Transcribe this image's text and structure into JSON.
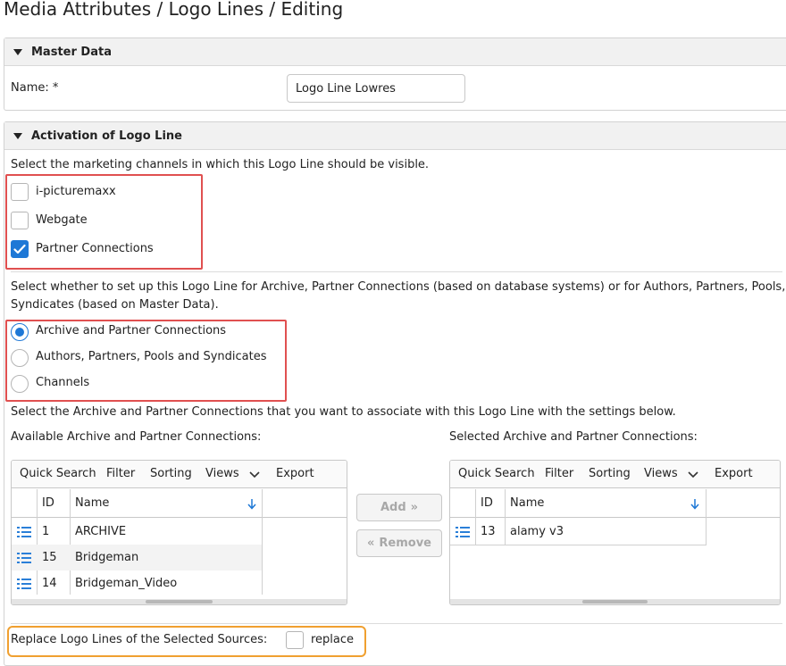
{
  "page_title": "Media Attributes / Logo Lines / Editing",
  "master_data": {
    "header": "Master Data",
    "name_label": "Name: *",
    "name_value": "Logo Line Lowres"
  },
  "activation": {
    "header": "Activation of Logo Line",
    "channels_prompt": "Select the marketing channels in which this Logo Line should be visible.",
    "channels": [
      {
        "label": "i-picturemaxx",
        "checked": false
      },
      {
        "label": "Webgate",
        "checked": false
      },
      {
        "label": "Partner Connections",
        "checked": true
      }
    ],
    "setup_prompt_line1": "Select whether to set up this Logo Line for Archive, Partner Connections (based on database systems) or for Authors, Partners, Pools,",
    "setup_prompt_line2": "Syndicates (based on Master Data).",
    "setup_options": [
      {
        "label": "Archive and Partner Connections",
        "selected": true
      },
      {
        "label": "Authors, Partners, Pools and Syndicates",
        "selected": false
      },
      {
        "label": "Channels",
        "selected": false
      }
    ],
    "associate_prompt": "Select the Archive and Partner Connections that you want to associate with this Logo Line with the settings below."
  },
  "available": {
    "label": "Available Archive and Partner Connections:",
    "toolbar": {
      "quick_search": "Quick Search",
      "filter": "Filter",
      "sorting": "Sorting",
      "views": "Views",
      "export": "Export"
    },
    "columns": {
      "id": "ID",
      "name": "Name"
    },
    "rows": [
      {
        "id": "1",
        "name": "ARCHIVE"
      },
      {
        "id": "15",
        "name": "Bridgeman"
      },
      {
        "id": "14",
        "name": "Bridgeman_Video"
      }
    ]
  },
  "selected": {
    "label": "Selected Archive and Partner Connections:",
    "toolbar": {
      "quick_search": "Quick Search",
      "filter": "Filter",
      "sorting": "Sorting",
      "views": "Views",
      "export": "Export"
    },
    "columns": {
      "id": "ID",
      "name": "Name"
    },
    "rows": [
      {
        "id": "13",
        "name": "alamy v3"
      }
    ]
  },
  "buttons": {
    "add": "Add",
    "remove": "Remove"
  },
  "replace": {
    "label": "Replace Logo Lines of the Selected Sources:",
    "checkbox_label": "replace",
    "checked": false
  },
  "colors": {
    "accent": "#1e78d6",
    "highlight_red": "#e05050",
    "highlight_orange": "#f0a030"
  }
}
